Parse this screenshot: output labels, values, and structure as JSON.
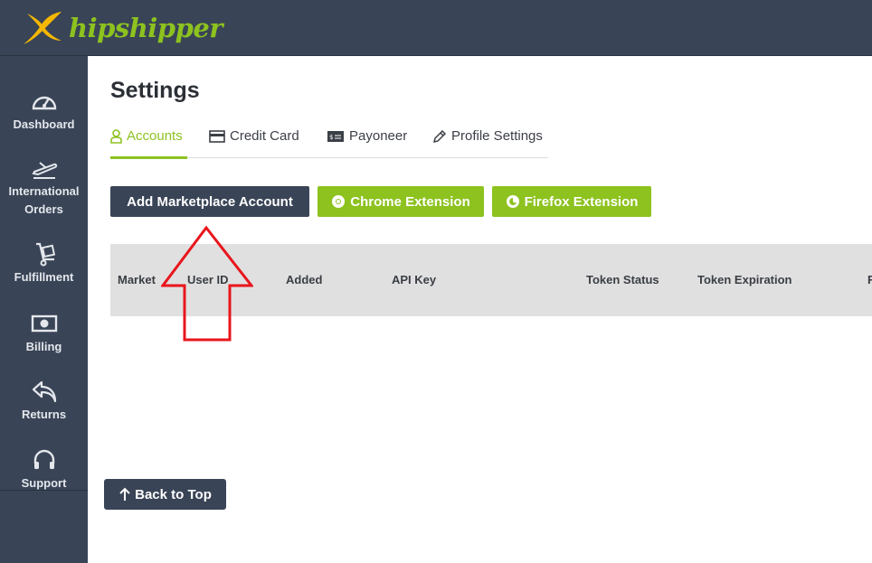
{
  "brand": {
    "name": "hipshipper",
    "accent": "#8dc21f",
    "logo_color": "#f5b800"
  },
  "sidebar": {
    "items": [
      {
        "label": "Dashboard",
        "icon": "speedometer-icon"
      },
      {
        "label": "International Orders",
        "line1": "International",
        "line2": "Orders",
        "icon": "airplane-icon"
      },
      {
        "label": "Fulfillment",
        "icon": "hand-truck-icon"
      },
      {
        "label": "Billing",
        "icon": "banknote-icon"
      },
      {
        "label": "Returns",
        "icon": "return-arrow-icon"
      },
      {
        "label": "Support",
        "icon": "headset-icon"
      }
    ]
  },
  "page": {
    "title": "Settings"
  },
  "tabs": [
    {
      "label": "Accounts",
      "icon": "user-icon",
      "active": true
    },
    {
      "label": "Credit Card",
      "icon": "credit-card-icon",
      "active": false
    },
    {
      "label": "Payoneer",
      "icon": "payoneer-icon",
      "active": false
    },
    {
      "label": "Profile Settings",
      "icon": "pencil-icon",
      "active": false
    }
  ],
  "actions": {
    "add_account": "Add Marketplace Account",
    "chrome": "Chrome Extension",
    "firefox": "Firefox Extension"
  },
  "table": {
    "columns": [
      "Market",
      "User ID",
      "Added",
      "API Key",
      "Token Status",
      "Token Expiration",
      "R"
    ]
  },
  "back_to_top": "Back to Top",
  "annotation": {
    "type": "arrow-up",
    "color": "#e8161c"
  }
}
